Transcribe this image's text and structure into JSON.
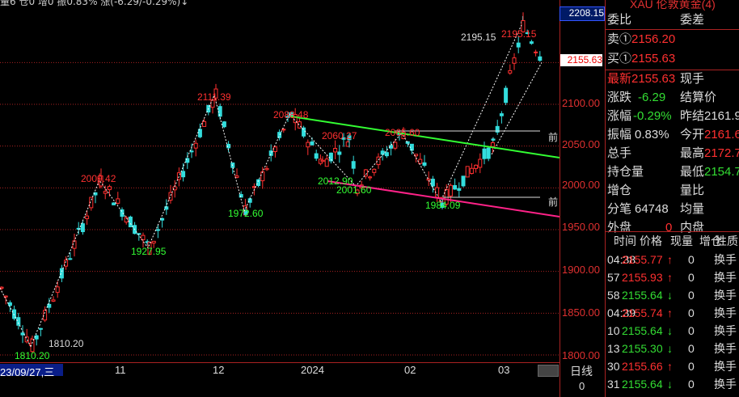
{
  "header": {
    "strip_text": "量6  仓0 增0 振0.83%  涨(-6.29/-0.29%)↓"
  },
  "price_axis": {
    "top_value": "2208.15",
    "current_value": "2155.63",
    "labels": [
      "2100.00",
      "2050.00",
      "2000.00",
      "1950.00",
      "1900.00",
      "1850.00",
      "1800.00"
    ]
  },
  "panel": {
    "title": "XAU 伦敦黄金(4)",
    "wei_bi_label": "委比",
    "wei_cha_label": "委差",
    "sell_label": "卖①",
    "sell_value": "2156.20",
    "buy_label": "买①",
    "buy_value": "2155.63",
    "latest_label": "最新",
    "latest_value": "2155.63",
    "now_hand_label": "现手",
    "change_label": "涨跌",
    "change_value": "-6.29",
    "settle_label": "结算价",
    "change_pct_label": "涨幅",
    "change_pct_value": "-0.29%",
    "prev_settle_label": "昨结",
    "prev_settle_value": "2161.9",
    "amplitude_label": "振幅",
    "amplitude_value": "0.83%",
    "open_label": "今开",
    "open_value": "2161.6",
    "total_hand_label": "总手",
    "high_label": "最高",
    "high_value": "2172.7",
    "position_label": "持仓量",
    "low_label": "最低",
    "low_value": "2154.7",
    "add_pos_label": "增仓",
    "vol_ratio_label": "量比",
    "ticks_label": "分笔",
    "ticks_value": "64748",
    "avg_label": "均量",
    "outer_label": "外盘",
    "outer_value": "0",
    "inner_label": "内盘",
    "tick_headers": [
      "时间",
      "价格",
      "现量",
      "增仓",
      "性质"
    ],
    "tick_rows": [
      {
        "time": "04:38",
        "price": "2155.77",
        "arrow": "↑",
        "vol": "0",
        "nature": "换手",
        "color": "#ff3030"
      },
      {
        "time": "57",
        "price": "2155.93",
        "arrow": "↑",
        "vol": "0",
        "nature": "换手",
        "color": "#ff3030"
      },
      {
        "time": "58",
        "price": "2155.64",
        "arrow": "↓",
        "vol": "0",
        "nature": "换手",
        "color": "#33dd33"
      },
      {
        "time": "04:39",
        "price": "2155.74",
        "arrow": "↑",
        "vol": "0",
        "nature": "换手",
        "color": "#ff3030"
      },
      {
        "time": "10",
        "price": "2155.64",
        "arrow": "↓",
        "vol": "0",
        "nature": "换手",
        "color": "#33dd33"
      },
      {
        "time": "13",
        "price": "2155.30",
        "arrow": "↓",
        "vol": "0",
        "nature": "换手",
        "color": "#33dd33"
      },
      {
        "time": "30",
        "price": "2155.66",
        "arrow": "↑",
        "vol": "0",
        "nature": "换手",
        "color": "#ff3030"
      },
      {
        "time": "31",
        "price": "2155.64",
        "arrow": "↓",
        "vol": "0",
        "nature": "换手",
        "color": "#33dd33"
      }
    ]
  },
  "bottom_bar": {
    "date_label": "23/09/27,三",
    "months": [
      "11",
      "12",
      "2024",
      "02",
      "03"
    ],
    "period": "日线",
    "zero": "0"
  },
  "annotations": {
    "p1": "1810.20",
    "p1b": "1810.20",
    "p2": "2009.42",
    "p3": "1927.95",
    "p4": "2111.39",
    "p5": "1972.60",
    "p6": "2088.48",
    "p7": "2060.27",
    "p8": "2012.90",
    "p9": "2001.60",
    "p10": "2065.60",
    "p11": "1984.09",
    "p12": "2195.15",
    "p12b": "2195.15",
    "qian1": "前",
    "qian2": "前"
  },
  "colors": {
    "up": "#ff3030",
    "down": "#33dddd",
    "green_line": "#33ff33",
    "pink_line": "#ff2288",
    "grid": "#aa2222"
  }
}
